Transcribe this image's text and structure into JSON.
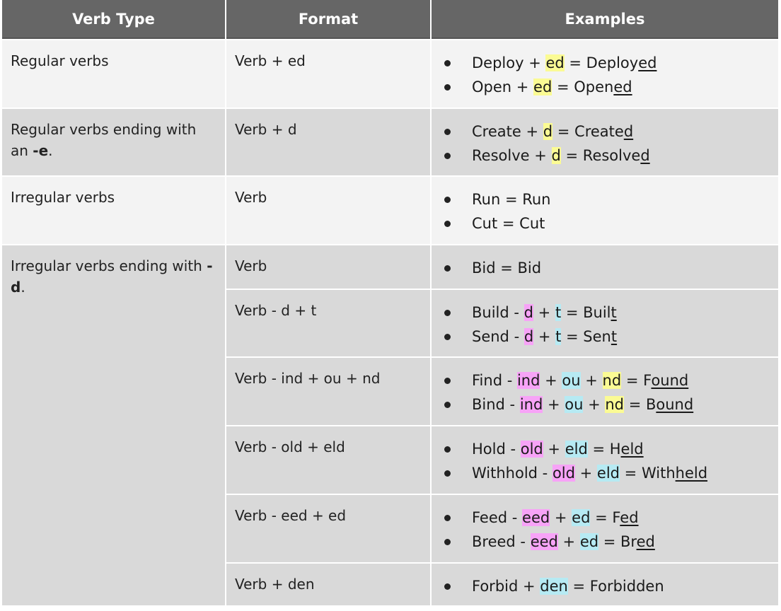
{
  "header": {
    "col1": "Verb Type",
    "col2": "Format",
    "col3": "Examples"
  },
  "highlight_colors": {
    "yellow": "#fbfb94",
    "pink": "#f7a3f7",
    "cyan": "#b6eaf3"
  },
  "rows": [
    {
      "type_text": "Regular verbs",
      "type_bold": "",
      "type_suffix": "",
      "format": "Verb + ed",
      "examples": [
        [
          {
            "t": "Deploy + "
          },
          {
            "t": "ed",
            "hl": "y"
          },
          {
            "t": " = Deploy"
          },
          {
            "t": "ed",
            "u": true
          }
        ],
        [
          {
            "t": "Open + "
          },
          {
            "t": "ed",
            "hl": "y"
          },
          {
            "t": " = Open"
          },
          {
            "t": "ed",
            "u": true
          }
        ]
      ]
    },
    {
      "type_text": "Regular verbs ending with an ",
      "type_bold": "-e",
      "type_suffix": ".",
      "format": "Verb + d",
      "examples": [
        [
          {
            "t": "Create + "
          },
          {
            "t": "d",
            "hl": "y"
          },
          {
            "t": " = Create"
          },
          {
            "t": "d",
            "u": true
          }
        ],
        [
          {
            "t": "Resolve + "
          },
          {
            "t": "d",
            "hl": "y"
          },
          {
            "t": " = Resolve"
          },
          {
            "t": "d",
            "u": true
          }
        ]
      ]
    },
    {
      "type_text": "Irregular verbs",
      "type_bold": "",
      "type_suffix": "",
      "format": "Verb",
      "examples": [
        [
          {
            "t": "Run = Run"
          }
        ],
        [
          {
            "t": "Cut = Cut"
          }
        ]
      ]
    }
  ],
  "irregular_d": {
    "type_text": "Irregular verbs ending with ",
    "type_bold": "-d",
    "type_suffix": ".",
    "subrows": [
      {
        "format": "Verb",
        "examples": [
          [
            {
              "t": "Bid = Bid"
            }
          ]
        ]
      },
      {
        "format": "Verb - d + t",
        "examples": [
          [
            {
              "t": "Build - "
            },
            {
              "t": "d",
              "hl": "p"
            },
            {
              "t": " + "
            },
            {
              "t": "t",
              "hl": "c"
            },
            {
              "t": " = Buil"
            },
            {
              "t": "t",
              "u": true
            }
          ],
          [
            {
              "t": "Send - "
            },
            {
              "t": "d",
              "hl": "p"
            },
            {
              "t": " + "
            },
            {
              "t": "t",
              "hl": "c"
            },
            {
              "t": " = Sen"
            },
            {
              "t": "t",
              "u": true
            }
          ]
        ]
      },
      {
        "format": "Verb - ind + ou + nd",
        "examples": [
          [
            {
              "t": "Find - "
            },
            {
              "t": "ind",
              "hl": "p"
            },
            {
              "t": " + "
            },
            {
              "t": "ou",
              "hl": "c"
            },
            {
              "t": " + "
            },
            {
              "t": "nd",
              "hl": "y"
            },
            {
              "t": " = F"
            },
            {
              "t": "ound",
              "u": true
            }
          ],
          [
            {
              "t": "Bind - "
            },
            {
              "t": "ind",
              "hl": "p"
            },
            {
              "t": " + "
            },
            {
              "t": "ou",
              "hl": "c"
            },
            {
              "t": " + "
            },
            {
              "t": "nd",
              "hl": "y"
            },
            {
              "t": " = B"
            },
            {
              "t": "ound",
              "u": true
            }
          ]
        ]
      },
      {
        "format": "Verb - old + eld",
        "examples": [
          [
            {
              "t": "Hold - "
            },
            {
              "t": "old",
              "hl": "p"
            },
            {
              "t": " + "
            },
            {
              "t": "eld",
              "hl": "c"
            },
            {
              "t": " = H"
            },
            {
              "t": "eld",
              "u": true
            }
          ],
          [
            {
              "t": "Withhold - "
            },
            {
              "t": "old",
              "hl": "p"
            },
            {
              "t": " + "
            },
            {
              "t": "eld",
              "hl": "c"
            },
            {
              "t": " = With"
            },
            {
              "t": "held",
              "u": true
            }
          ]
        ]
      },
      {
        "format": "Verb - eed + ed",
        "examples": [
          [
            {
              "t": "Feed - "
            },
            {
              "t": "eed",
              "hl": "p"
            },
            {
              "t": " + "
            },
            {
              "t": "ed",
              "hl": "c"
            },
            {
              "t": " = F"
            },
            {
              "t": "ed",
              "u": true
            }
          ],
          [
            {
              "t": "Breed - "
            },
            {
              "t": "eed",
              "hl": "p"
            },
            {
              "t": " + "
            },
            {
              "t": "ed",
              "hl": "c"
            },
            {
              "t": " = Br"
            },
            {
              "t": "ed",
              "u": true
            }
          ]
        ]
      },
      {
        "format": "Verb + den",
        "examples": [
          [
            {
              "t": "Forbid + "
            },
            {
              "t": "den",
              "hl": "c"
            },
            {
              "t": " = Forbidden"
            }
          ]
        ]
      }
    ]
  }
}
